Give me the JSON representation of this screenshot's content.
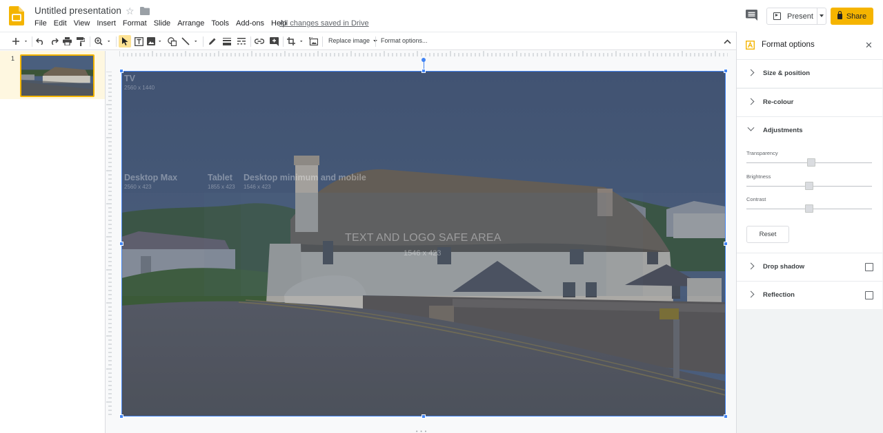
{
  "header": {
    "title": "Untitled presentation",
    "menu": [
      "File",
      "Edit",
      "View",
      "Insert",
      "Format",
      "Slide",
      "Arrange",
      "Tools",
      "Add-ons",
      "Help"
    ],
    "saved_status": "All changes saved in Drive",
    "present_label": "Present",
    "share_label": "Share",
    "brand_color": "#f4b400"
  },
  "toolbar": {
    "replace_image_label": "Replace image",
    "format_options_label": "Format options..."
  },
  "filmstrip": {
    "slides": [
      {
        "number": "1",
        "selected": true
      }
    ]
  },
  "slide": {
    "overlay": {
      "tv_label": "TV",
      "tv_dims": "2560 x 1440",
      "desktop_max_label": "Desktop Max",
      "desktop_max_dims": "2560 x 423",
      "tablet_label": "Tablet",
      "tablet_dims": "1855 x 423",
      "desktop_min_label": "Desktop minimum and mobile",
      "desktop_min_dims": "1546 x 423",
      "safe_area_label": "TEXT AND LOGO SAFE AREA",
      "safe_area_dims": "1546 x 423"
    }
  },
  "panel": {
    "title": "Format options",
    "sections": {
      "size_position": "Size & position",
      "recolour": "Re-colour",
      "adjustments": "Adjustments",
      "drop_shadow": "Drop shadow",
      "reflection": "Reflection"
    },
    "adjustments": {
      "transparency_label": "Transparency",
      "transparency_value": 0.52,
      "brightness_label": "Brightness",
      "brightness_value": 0.5,
      "contrast_label": "Contrast",
      "contrast_value": 0.5,
      "reset_label": "Reset"
    },
    "drop_shadow_checked": false,
    "reflection_checked": false
  }
}
